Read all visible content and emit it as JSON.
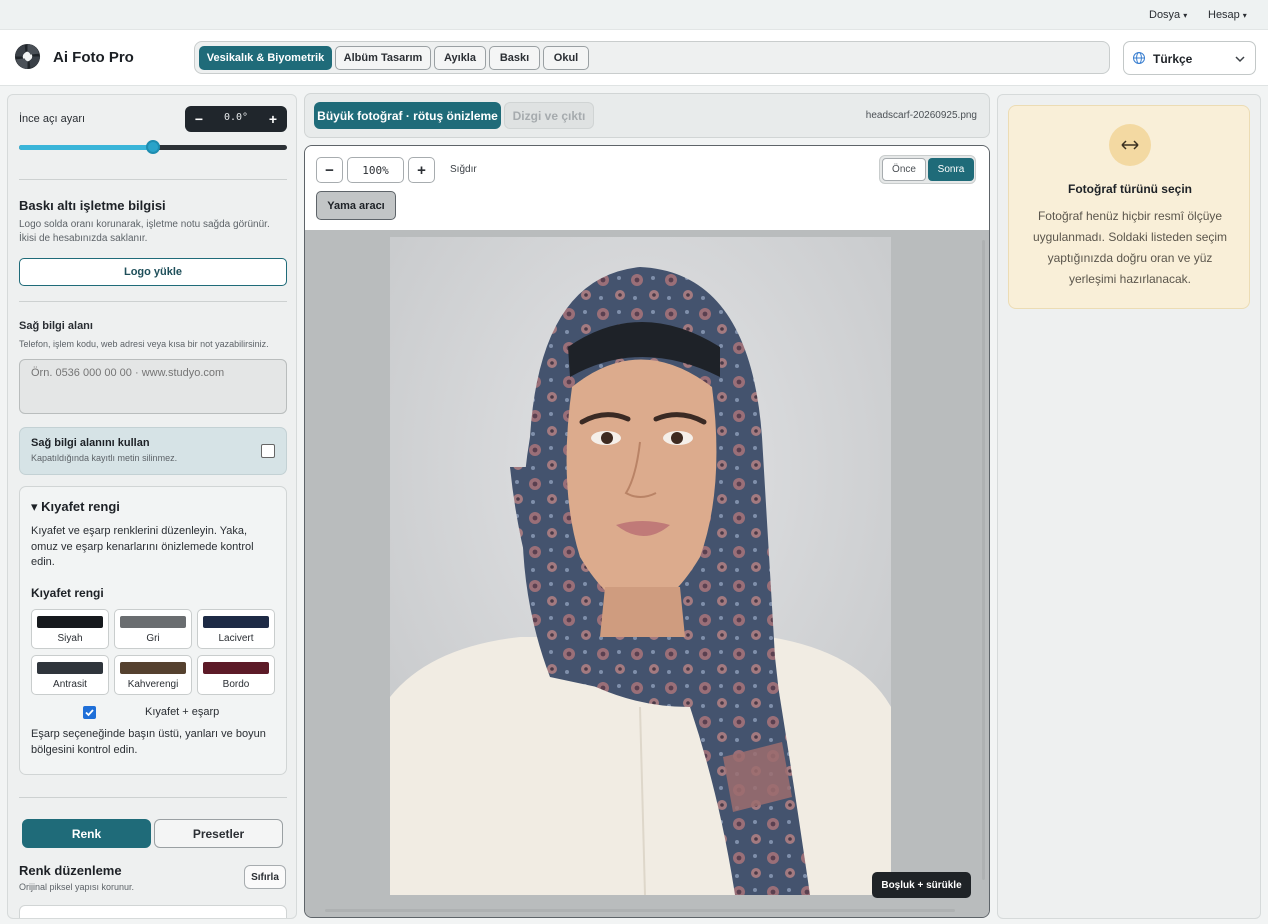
{
  "menu": {
    "file": "Dosya",
    "account": "Hesap",
    "caret": "▾"
  },
  "app": {
    "name": "Ai Foto Pro",
    "logo_icon": "aperture-icon"
  },
  "tabs": [
    "Vesikalık & Biyometrik",
    "Albüm Tasarım",
    "Ayıkla",
    "Baskı",
    "Okul"
  ],
  "active_tab": "Vesikalık & Biyometrik",
  "language": {
    "label": "Türkçe",
    "icon": "globe-icon"
  },
  "accent_color": "#1f6b79",
  "left": {
    "angle_label": "İnce açı ayarı",
    "angle_minus": "−",
    "angle_plus": "+",
    "angle_value": "0.0°",
    "angle_slider_fraction": 0.5,
    "print_section_title": "Baskı altı işletme bilgisi",
    "print_section_help": "Logo solda oranı korunarak, işletme notu sağda görünür. İkisi de hesabınızda saklanır.",
    "upload_logo": "Logo yükle",
    "right_info_title": "Sağ bilgi alanı",
    "right_info_help": "Telefon, işlem kodu, web adresi veya kısa bir not yazabilirsiniz.",
    "right_info_placeholder": "Örn. 0536 000 00 00 · www.studyo.com",
    "use_right_info_title": "Sağ bilgi alanını kullan",
    "use_right_info_help": "Kapatıldığında kayıtlı metin silinmez.",
    "use_right_info_checked": false,
    "clothing": {
      "title": "▾ Kıyafet rengi",
      "description": "Kıyafet ve eşarp renklerini düzenleyin. Yaka, omuz ve eşarp kenarlarını önizlemede kontrol edin.",
      "subtitle": "Kıyafet rengi",
      "swatches": [
        {
          "label": "Siyah",
          "color": "#16191d"
        },
        {
          "label": "Gri",
          "color": "#6a6d70"
        },
        {
          "label": "Lacivert",
          "color": "#1d2a45"
        },
        {
          "label": "Antrasit",
          "color": "#2f353c"
        },
        {
          "label": "Kahverengi",
          "color": "#55412f"
        },
        {
          "label": "Bordo",
          "color": "#5c1a27"
        }
      ],
      "scarf_checkbox_label": "Kıyafet + eşarp",
      "scarf_checked": true,
      "note": "Eşarp seçeneğinde başın üstü, yanları ve boyun bölgesini kontrol edin."
    },
    "mode_tabs": [
      "Renk",
      "Presetler"
    ],
    "color_edit_title": "Renk düzenleme",
    "color_edit_help": "Orijinal piksel yapısı korunur.",
    "reset": "Sıfırla"
  },
  "center": {
    "tabs": [
      "Büyük fotoğraf · rötuş önizleme",
      "Dizgi ve çıktı"
    ],
    "filename": "headscarf-20260925.png",
    "zoom_minus": "−",
    "zoom_value": "100%",
    "zoom_plus": "+",
    "fit": "Sığdır",
    "before": "Önce",
    "after": "Sonra",
    "patch_tool": "Yama aracı",
    "pan_hint": "Boşluk + sürükle"
  },
  "right": {
    "icon": "swap-arrows-icon",
    "title": "Fotoğraf türünü seçin",
    "text": "Fotoğraf henüz hiçbir resmî ölçüye uygulanmadı. Soldaki listeden seçim yaptığınızda doğru oran ve yüz yerleşimi hazırlanacak."
  }
}
